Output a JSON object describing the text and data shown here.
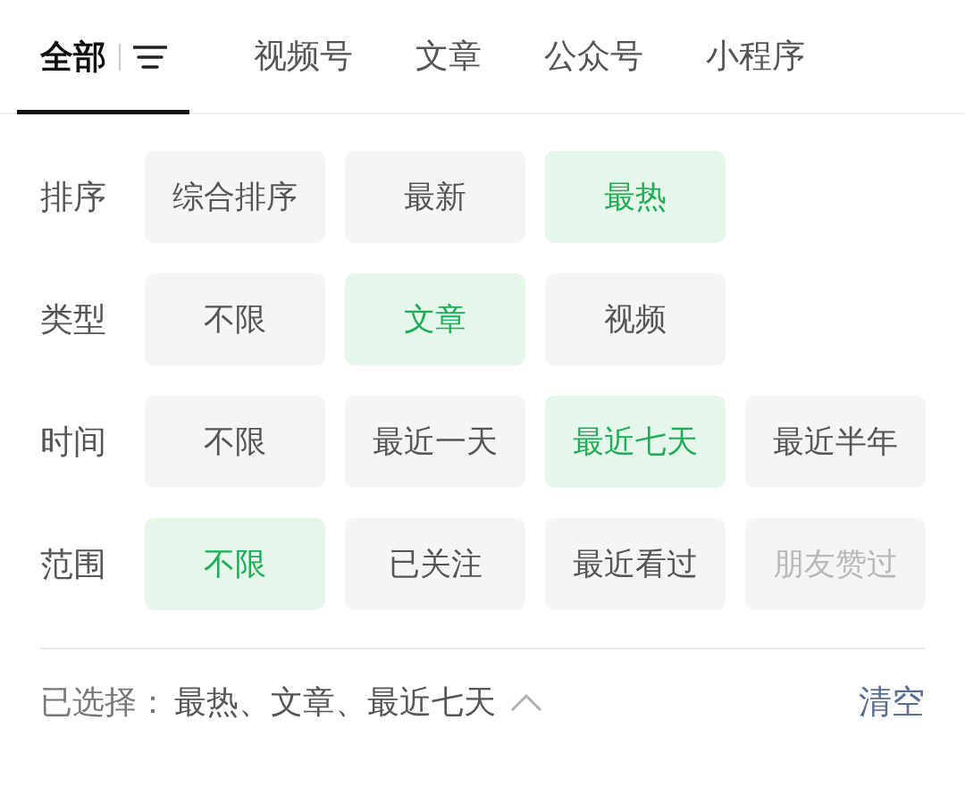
{
  "tabs": [
    {
      "label": "全部",
      "selected": true
    },
    {
      "label": "视频号",
      "selected": false
    },
    {
      "label": "文章",
      "selected": false
    },
    {
      "label": "公众号",
      "selected": false
    },
    {
      "label": "小程序",
      "selected": false
    }
  ],
  "filters": [
    {
      "label": "排序",
      "options": [
        {
          "label": "综合排序",
          "selected": false,
          "disabled": false
        },
        {
          "label": "最新",
          "selected": false,
          "disabled": false
        },
        {
          "label": "最热",
          "selected": true,
          "disabled": false
        }
      ]
    },
    {
      "label": "类型",
      "options": [
        {
          "label": "不限",
          "selected": false,
          "disabled": false
        },
        {
          "label": "文章",
          "selected": true,
          "disabled": false
        },
        {
          "label": "视频",
          "selected": false,
          "disabled": false
        }
      ]
    },
    {
      "label": "时间",
      "options": [
        {
          "label": "不限",
          "selected": false,
          "disabled": false
        },
        {
          "label": "最近一天",
          "selected": false,
          "disabled": false
        },
        {
          "label": "最近七天",
          "selected": true,
          "disabled": false
        },
        {
          "label": "最近半年",
          "selected": false,
          "disabled": false
        }
      ]
    },
    {
      "label": "范围",
      "options": [
        {
          "label": "不限",
          "selected": true,
          "disabled": false
        },
        {
          "label": "已关注",
          "selected": false,
          "disabled": false
        },
        {
          "label": "最近看过",
          "selected": false,
          "disabled": false
        },
        {
          "label": "朋友赞过",
          "selected": false,
          "disabled": true
        }
      ]
    }
  ],
  "summary": {
    "prefix": "已选择：",
    "value": "最热、文章、最近七天",
    "expanded": true
  },
  "clear": "清空"
}
